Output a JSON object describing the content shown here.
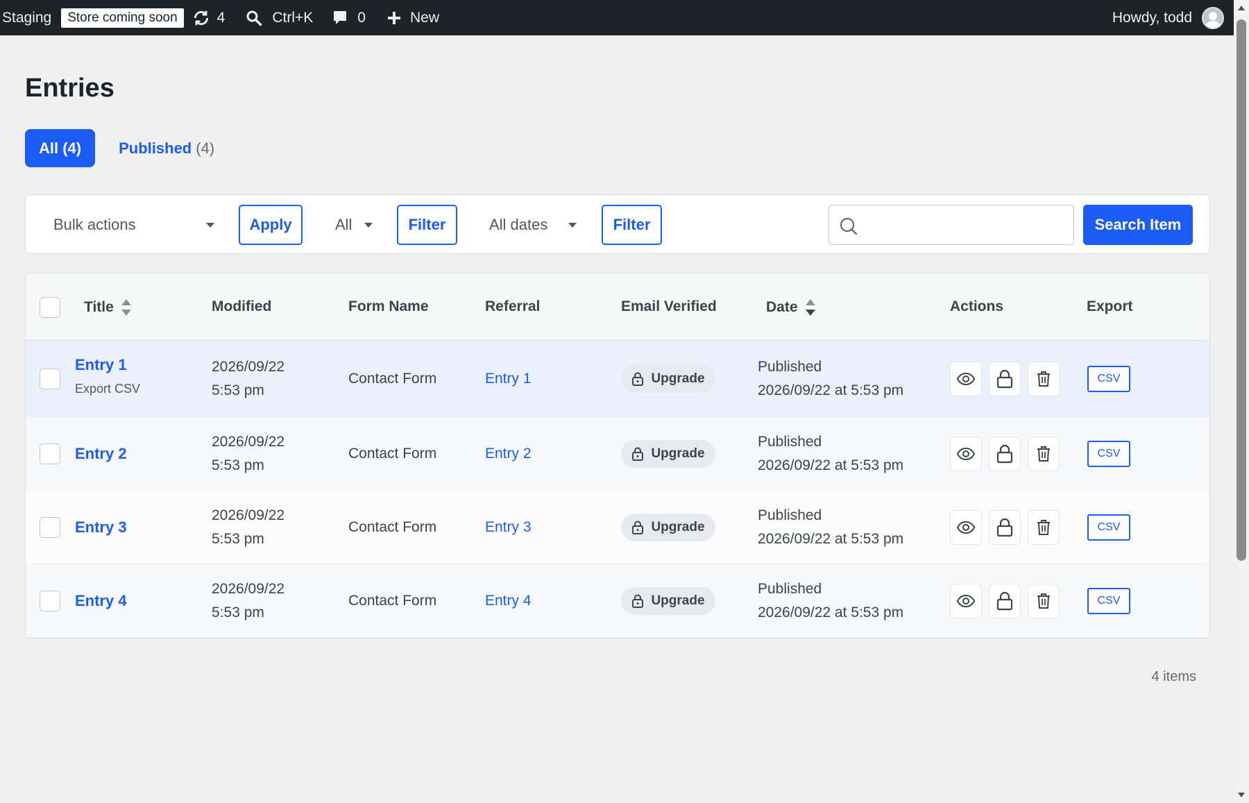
{
  "adminbar": {
    "site_name": "Staging",
    "badge": "Store coming soon",
    "updates_count": "4",
    "search_shortcut": "Ctrl+K",
    "comments_count": "0",
    "new_label": "New",
    "greeting": "Howdy, todd",
    "icons": [
      "updates-icon",
      "search-icon",
      "comment-icon",
      "plus-icon"
    ]
  },
  "page": {
    "title": "Entries"
  },
  "tabs": {
    "all_label": "All (4)",
    "published_label": "Published",
    "published_count": "(4)"
  },
  "toolbar": {
    "bulk_actions": "Bulk actions",
    "apply": "Apply",
    "form_filter": "All",
    "filter1": "Filter",
    "dates": "All dates",
    "filter2": "Filter",
    "search_value": "",
    "search_button": "Search Item"
  },
  "table": {
    "columns": {
      "title": "Title",
      "modified": "Modified",
      "form_name": "Form Name",
      "referral": "Referral",
      "email_verified": "Email Verified",
      "date": "Date",
      "actions": "Actions",
      "export": "Export"
    },
    "rows": [
      {
        "title": "Entry 1",
        "row_action": "Export CSV",
        "modified_date": "2026/09/22",
        "modified_time": "5:53 pm",
        "form_name": "Contact Form",
        "referral": "Entry 1",
        "email_verified": "Upgrade",
        "status": "Published",
        "date": "2026/09/22 at 5:53 pm",
        "export": "CSV"
      },
      {
        "title": "Entry 2",
        "row_action": "",
        "modified_date": "2026/09/22",
        "modified_time": "5:53 pm",
        "form_name": "Contact Form",
        "referral": "Entry 2",
        "email_verified": "Upgrade",
        "status": "Published",
        "date": "2026/09/22 at 5:53 pm",
        "export": "CSV"
      },
      {
        "title": "Entry 3",
        "row_action": "",
        "modified_date": "2026/09/22",
        "modified_time": "5:53 pm",
        "form_name": "Contact Form",
        "referral": "Entry 3",
        "email_verified": "Upgrade",
        "status": "Published",
        "date": "2026/09/22 at 5:53 pm",
        "export": "CSV"
      },
      {
        "title": "Entry 4",
        "row_action": "",
        "modified_date": "2026/09/22",
        "modified_time": "5:53 pm",
        "form_name": "Contact Form",
        "referral": "Entry 4",
        "email_verified": "Upgrade",
        "status": "Published",
        "date": "2026/09/22 at 5:53 pm",
        "export": "CSV"
      }
    ]
  },
  "footer": {
    "items_count": "4 items"
  },
  "colors": {
    "accent": "#1a5cf5",
    "adminbar_bg": "#1d2327",
    "page_bg": "#f0f0f1"
  }
}
